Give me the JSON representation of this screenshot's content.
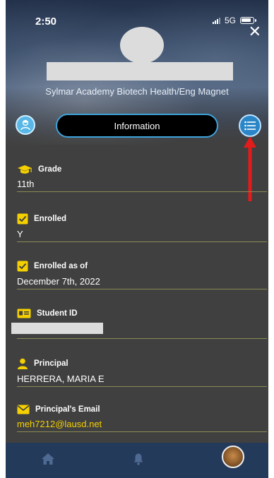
{
  "status_bar": {
    "time": "2:50",
    "network": "5G"
  },
  "header": {
    "school_name": "Sylmar Academy Biotech Health/Eng Magnet",
    "close_symbol": "✕"
  },
  "tabs": {
    "active_label": "Information"
  },
  "fields": [
    {
      "label": "Grade",
      "value": "11th",
      "icon": "graduation-cap-icon"
    },
    {
      "label": "Enrolled",
      "value": "Y",
      "icon": "checkbox-icon"
    },
    {
      "label": "Enrolled as of",
      "value": "December 7th, 2022",
      "icon": "checkbox-icon"
    },
    {
      "label": "Student ID",
      "value": "",
      "icon": "id-card-icon"
    },
    {
      "label": "Principal",
      "value": "HERRERA, MARIA E",
      "icon": "person-icon"
    },
    {
      "label": "Principal's Email",
      "value": "meh7212@lausd.net",
      "icon": "envelope-icon"
    }
  ],
  "colors": {
    "accent_yellow": "#f5d000",
    "pill_border": "#3da4dc",
    "bottom_nav": "#243a5a",
    "background": "#404040",
    "annotation_arrow": "#e21b1b"
  }
}
